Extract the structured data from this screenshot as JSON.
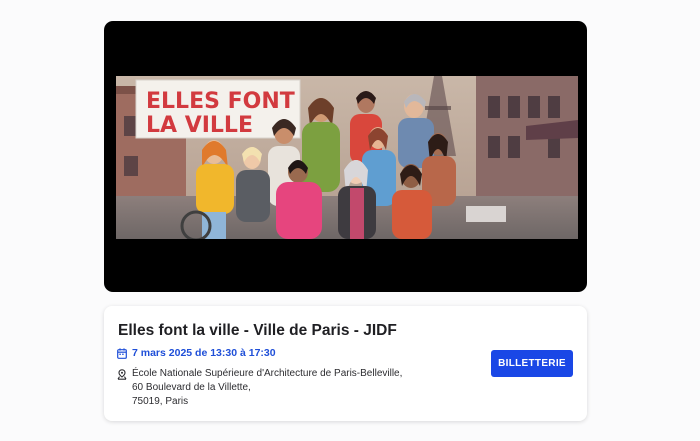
{
  "banner": {
    "sign_line1": "ELLES FONT",
    "sign_line2": "LA VILLE"
  },
  "event": {
    "title": "Elles font la ville - Ville de Paris - JIDF",
    "date": "7 mars 2025 de 13:30 à 17:30",
    "address_lines": [
      "École Nationale Supérieure d'Architecture de Paris-Belleville,",
      "60 Boulevard de la Villette,",
      "75019, Paris"
    ],
    "ticket_button": "BILLETTERIE"
  },
  "icons": {
    "date": "calendar-icon",
    "location": "location-pin-icon"
  },
  "colors": {
    "accent": "#1a47e6",
    "date_text": "#1f4fd8",
    "sign_text": "#d23a3f",
    "media_background": "#000000"
  }
}
